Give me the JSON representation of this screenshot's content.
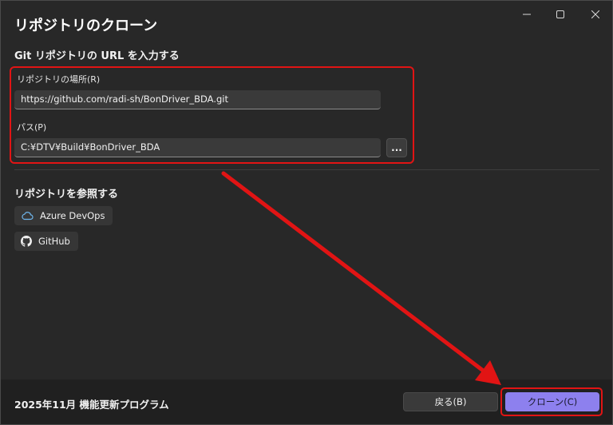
{
  "window": {
    "title": "リポジトリのクローン",
    "controls": [
      "minimize",
      "maximize",
      "close"
    ]
  },
  "url_section": {
    "heading": "Git リポジトリの URL を入力する",
    "location_label": "リポジトリの場所(R)",
    "location_value": "https://github.com/radi-sh/BonDriver_BDA.git",
    "path_label": "パス(P)",
    "path_value": "C:¥DTV¥Build¥BonDriver_BDA",
    "browse_label": "..."
  },
  "browse_section": {
    "heading": "リポジトリを参照する",
    "providers": [
      {
        "label": "Azure DevOps",
        "icon": "cloud-icon"
      },
      {
        "label": "GitHub",
        "icon": "github-icon"
      }
    ]
  },
  "footer": {
    "text": "2025年11月 機能更新プログラム",
    "back_label": "戻る(B)",
    "clone_label": "クローン(C)"
  },
  "colors": {
    "accent": "#8d80ee",
    "highlight": "#e11414",
    "background": "#282828"
  }
}
